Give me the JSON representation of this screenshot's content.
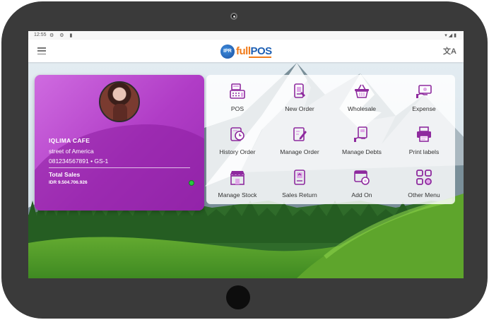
{
  "status_bar": {
    "time": "12:55",
    "left_icons": "⚙ ⚙ ▮",
    "right_icons": "▾◢▮"
  },
  "app_bar": {
    "logo_badge": "IPR",
    "logo_part1": "full",
    "logo_part2": "POS",
    "translate_glyph": "文A"
  },
  "profile": {
    "store_name": "IQLIMA CAFE",
    "address": "street of America",
    "phone_line": "081234567891 • GS-1",
    "sales_label": "Total Sales",
    "sales_value": "IDR 9.504.706.926",
    "status_color": "#27c93f"
  },
  "menu": {
    "items": [
      {
        "label": "POS",
        "icon": "cash-register-icon"
      },
      {
        "label": "New Order",
        "icon": "new-order-icon"
      },
      {
        "label": "Wholesale",
        "icon": "basket-icon"
      },
      {
        "label": "Expense",
        "icon": "expense-icon"
      },
      {
        "label": "History Order",
        "icon": "history-order-icon"
      },
      {
        "label": "Manage Order",
        "icon": "manage-order-icon"
      },
      {
        "label": "Manage Debts",
        "icon": "manage-debts-icon"
      },
      {
        "label": "Print labels",
        "icon": "printer-icon"
      },
      {
        "label": "Manage Stock",
        "icon": "store-icon"
      },
      {
        "label": "Sales Return",
        "icon": "sales-return-icon"
      },
      {
        "label": "Add On",
        "icon": "add-on-icon"
      },
      {
        "label": "Other Menu",
        "icon": "grid-icon"
      }
    ]
  },
  "colors": {
    "accent": "#9c27b0",
    "card_start": "#cf6be0",
    "card_end": "#9a2db3",
    "logo_orange": "#f07b1a",
    "logo_blue": "#1d5fb3"
  }
}
